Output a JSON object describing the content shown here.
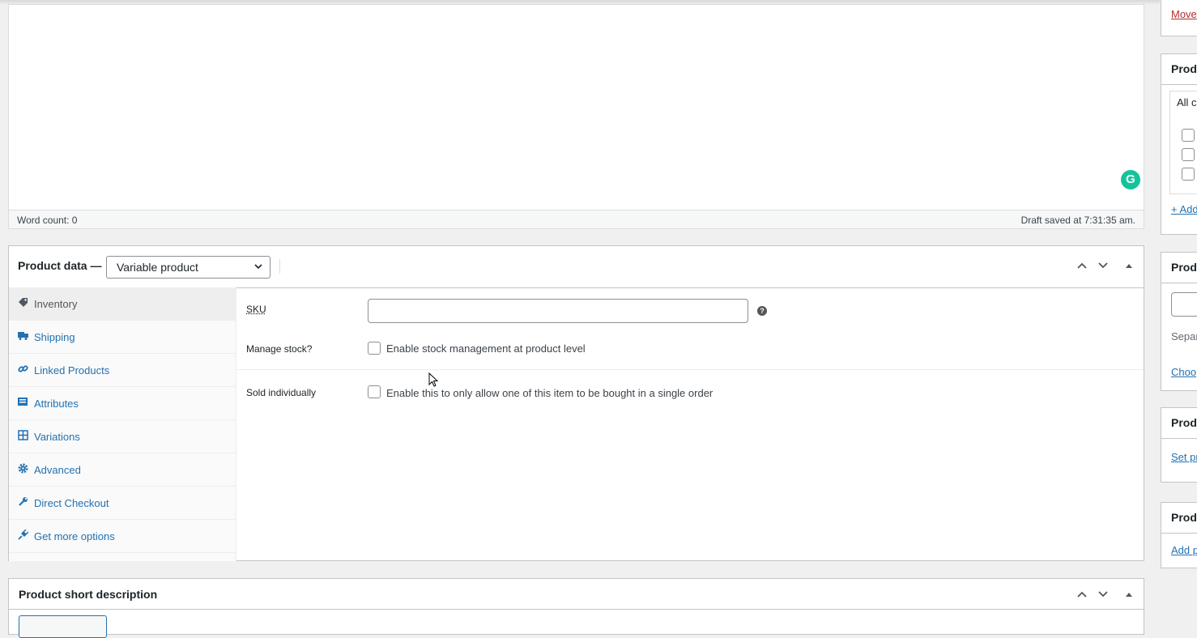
{
  "editor": {
    "word_count": "Word count: 0",
    "draft_saved": "Draft saved at 7:31:35 am.",
    "grammarly_letter": "G"
  },
  "product_data": {
    "title": "Product data —",
    "type_selected": "Variable product",
    "tabs": [
      {
        "label": "Inventory",
        "icon": "tag-icon",
        "active": true
      },
      {
        "label": "Shipping",
        "icon": "truck-icon"
      },
      {
        "label": "Linked Products",
        "icon": "link-icon"
      },
      {
        "label": "Attributes",
        "icon": "list-icon"
      },
      {
        "label": "Variations",
        "icon": "grid-icon"
      },
      {
        "label": "Advanced",
        "icon": "gear-icon"
      },
      {
        "label": "Direct Checkout",
        "icon": "wrench-icon"
      },
      {
        "label": "Get more options",
        "icon": "plugin-icon"
      }
    ],
    "inventory": {
      "sku_label": "SKU",
      "sku_value": "",
      "manage_stock_label": "Manage stock?",
      "manage_stock_text": "Enable stock management at product level",
      "sold_individually_label": "Sold individually",
      "sold_individually_text": "Enable this to only allow one of this item to be bought in a single order"
    }
  },
  "short_description": {
    "title": "Product short description"
  },
  "sidebar": {
    "move_link": "Move",
    "categories_title": "Produ",
    "categories_tab": "All ca",
    "add_category": "+ Add",
    "tags_title": "Produ",
    "tags_hint": "Separ",
    "tags_choose": "Choo",
    "image_title": "Produ",
    "image_link": "Set pr",
    "gallery_title": "Produ",
    "gallery_link": "Add p"
  }
}
